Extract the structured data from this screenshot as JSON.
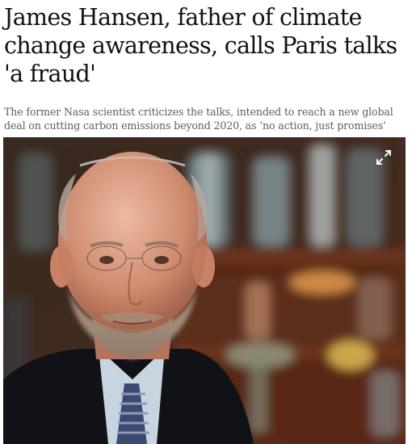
{
  "article": {
    "headline": "James Hansen, father of climate change awareness, calls Paris talks 'a fraud'",
    "standfirst": "The former Nasa scientist criticizes the talks, intended to reach a new global deal on cutting carbon emissions beyond 2020, as ‘no action, just promises’"
  },
  "image": {
    "expand_icon": "expand-icon"
  },
  "colors": {
    "headline": "#121212",
    "standfirst": "#5e5e5e",
    "background": "#ffffff"
  }
}
